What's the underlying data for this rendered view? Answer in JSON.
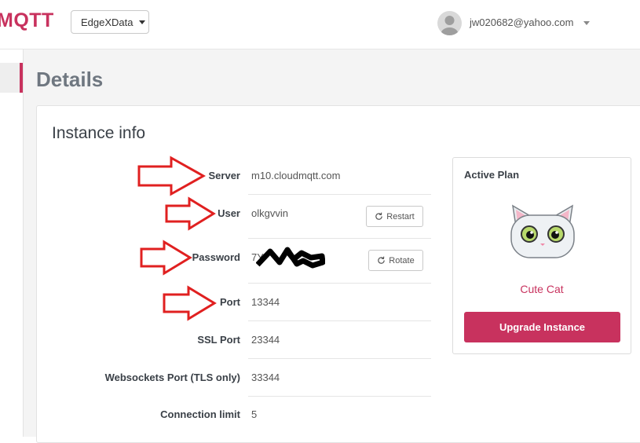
{
  "header": {
    "brand": "MQTT",
    "instance_selector": "EdgeXData",
    "user_email": "jw020682@yahoo.com"
  },
  "page": {
    "title": "Details"
  },
  "instance_info": {
    "title": "Instance info",
    "fields": [
      {
        "label": "Server",
        "value": "m10.cloudmqtt.com"
      },
      {
        "label": "User",
        "value": "olkgvvin"
      },
      {
        "label": "Password",
        "value": "7Y",
        "redacted": true
      },
      {
        "label": "Port",
        "value": "13344"
      },
      {
        "label": "SSL Port",
        "value": "23344"
      },
      {
        "label": "Websockets Port (TLS only)",
        "value": "33344"
      },
      {
        "label": "Connection limit",
        "value": "5"
      }
    ],
    "restart_label": "Restart",
    "rotate_label": "Rotate"
  },
  "plan": {
    "title": "Active Plan",
    "name": "Cute Cat",
    "upgrade_label": "Upgrade Instance",
    "icon": "cat-mascot-icon"
  },
  "annotations": {
    "arrow_color": "#e02020",
    "arrow_icon": "red-outline-arrow-icon"
  },
  "colors": {
    "accent": "#c8325e",
    "text": "#3a4047",
    "background": "#f4f4f4"
  }
}
